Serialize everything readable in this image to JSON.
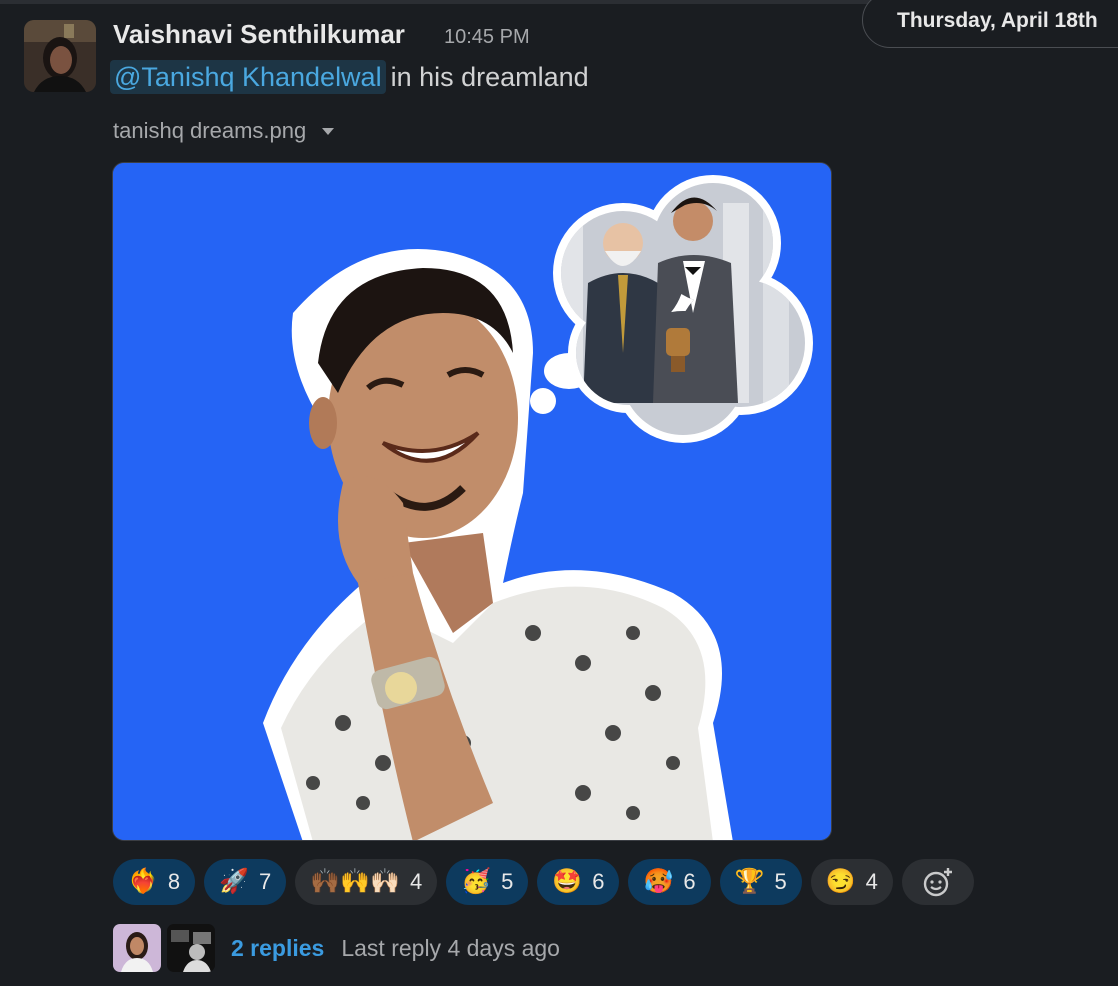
{
  "header": {
    "date_label": "Thursday, April 18th"
  },
  "message": {
    "author": "Vaishnavi Senthilkumar",
    "time": "10:45 PM",
    "mention": "@Tanishq Khandelwal",
    "text": "in his dreamland",
    "file_name": "tanishq dreams.png"
  },
  "reactions": [
    {
      "icon": "heart-on-fire-emoji",
      "glyph": "❤️‍🔥",
      "count": "8",
      "selected": true
    },
    {
      "icon": "rocket-emoji",
      "glyph": "🚀",
      "count": "7",
      "selected": true
    },
    {
      "icon": "raising-hands-emoji",
      "glyph": "🙌🏾🙌🙌🏻",
      "count": "4",
      "selected": false
    },
    {
      "icon": "partying-face-emoji",
      "glyph": "🥳",
      "count": "5",
      "selected": true
    },
    {
      "icon": "star-struck-emoji",
      "glyph": "🤩",
      "count": "6",
      "selected": true
    },
    {
      "icon": "hot-face-emoji",
      "glyph": "🥵",
      "count": "6",
      "selected": true
    },
    {
      "icon": "trophy-emoji",
      "glyph": "🏆",
      "count": "5",
      "selected": true
    },
    {
      "icon": "smirking-face-emoji",
      "glyph": "😏",
      "count": "4",
      "selected": false
    }
  ],
  "thread": {
    "replies_label": "2 replies",
    "last_reply": "Last reply 4 days ago"
  },
  "colors": {
    "background": "#1a1d21",
    "accent_link": "#3b9be0",
    "selected_reaction": "#0d3a5e",
    "image_background": "#2564f5"
  }
}
